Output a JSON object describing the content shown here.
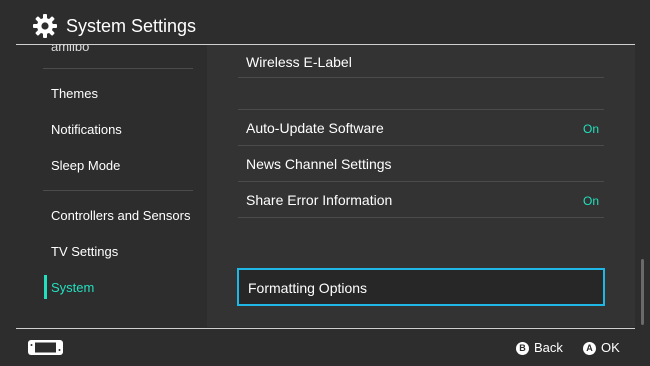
{
  "header": {
    "title": "System Settings",
    "icon": "gear-icon"
  },
  "sidebar": {
    "items": [
      {
        "label": "amiibo"
      },
      {
        "label": "Themes"
      },
      {
        "label": "Notifications"
      },
      {
        "label": "Sleep Mode"
      },
      {
        "label": "Controllers and Sensors"
      },
      {
        "label": "TV Settings"
      },
      {
        "label": "System",
        "active": true
      }
    ],
    "accent_color": "#22e0bf"
  },
  "main": {
    "rows": [
      {
        "label": "Wireless E-Label",
        "value": ""
      },
      {
        "label": "Auto-Update Software",
        "value": "On"
      },
      {
        "label": "News Channel Settings",
        "value": ""
      },
      {
        "label": "Share Error Information",
        "value": "On"
      }
    ],
    "focused": {
      "label": "Formatting Options"
    },
    "focus_color": "#1fb7e6"
  },
  "footer": {
    "console_icon": "console-icon",
    "back": {
      "button": "B",
      "label": "Back"
    },
    "ok": {
      "button": "A",
      "label": "OK"
    }
  }
}
